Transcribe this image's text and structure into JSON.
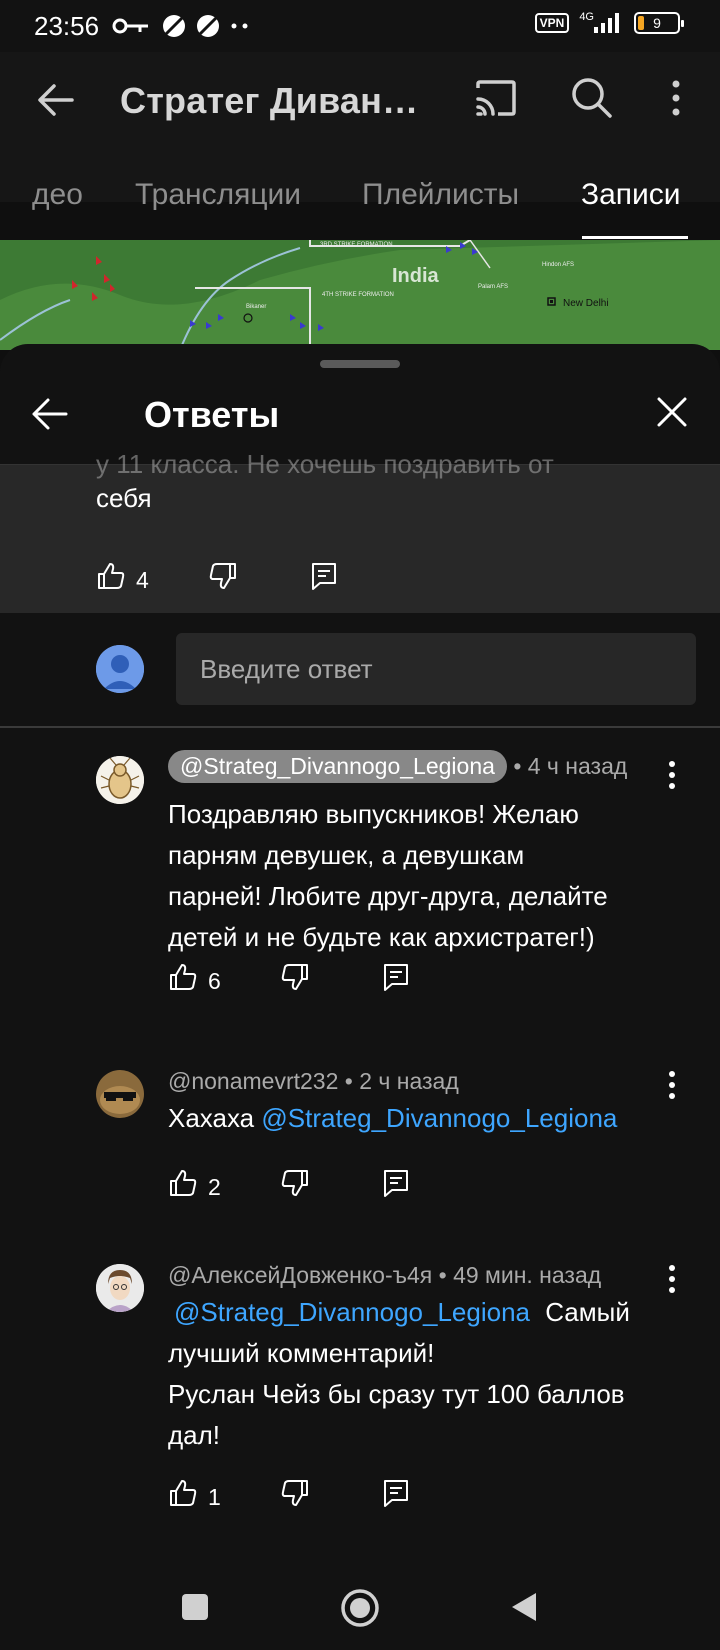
{
  "status_bar": {
    "time": "23:56",
    "vpn": "VPN",
    "network": "4G",
    "battery": "9"
  },
  "header": {
    "title": "Стратег Диван…",
    "icons": [
      "back-arrow-icon",
      "cast-icon",
      "search-icon",
      "more-vert-icon"
    ]
  },
  "tabs": [
    {
      "label": "део",
      "active": false
    },
    {
      "label": "Трансляции",
      "active": false
    },
    {
      "label": "Плейлисты",
      "active": false
    },
    {
      "label": "Записи",
      "active": true
    }
  ],
  "banner": {
    "map_label_country": "India",
    "map_label_city": "New Delhi",
    "map_label_formation_1": "3RD STRIKE FORMATION",
    "map_label_formation_2": "4TH STRIKE FORMATION",
    "map_label_bikaner": "Bikaner",
    "map_label_hindon": "Hindon AFS",
    "map_label_palam": "Palam AFS"
  },
  "sheet": {
    "title": "Ответы",
    "parent_comment": {
      "ghost_text": "у 11 класса. Не хочешь поздравить от",
      "text": "себя",
      "likes": "4"
    },
    "reply_placeholder": "Введите ответ"
  },
  "comments": [
    {
      "author": "@Strateg_Divannogo_Legiona",
      "time": "• 4 ч назад",
      "is_channel_author": true,
      "lines": [
        "Поздравляю выпускников! Желаю",
        "парням девушек, а девушкам",
        "парней! Любите друг-друга, делайте",
        "детей и не будьте как архистратег!)"
      ],
      "likes": "6"
    },
    {
      "author": "@nonamevrt232",
      "time": "• 2 ч назад",
      "is_channel_author": false,
      "text_prefix": "Хахаха",
      "mention": "@Strateg_Divannogo_Legiona",
      "likes": "2"
    },
    {
      "author": "@АлексейДовженко-ъ4я",
      "time": "• 49 мин. назад",
      "is_channel_author": false,
      "mention": "@Strateg_Divannogo_Legiona",
      "text_after_mention": "Самый",
      "lines": [
        "лучший комментарий!",
        "Руслан Чейз бы сразу тут 100 баллов",
        "дал!"
      ],
      "likes": "1"
    }
  ],
  "colors": {
    "background": "#0f0f0f",
    "parent_bg": "#282828",
    "mention": "#3ea6ff",
    "author_chip": "#888888"
  }
}
